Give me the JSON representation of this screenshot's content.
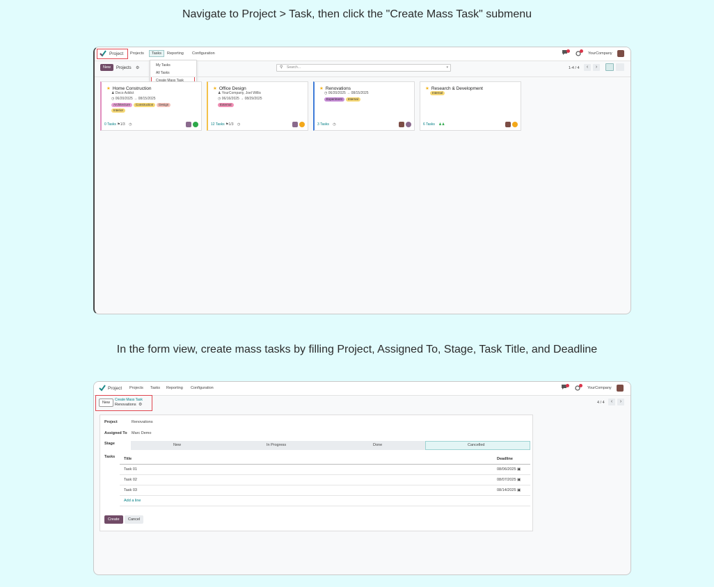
{
  "step1": {
    "caption": "Navigate to Project > Task, then click the \"Create Mass Task\" submenu",
    "nav": {
      "app": "Project",
      "menu": [
        "Projects",
        "Tasks",
        "Reporting",
        "Configuration"
      ],
      "company": "YourCompany"
    },
    "toolbar": {
      "new_label": "New",
      "breadcrumb": "Projects",
      "search_placeholder": "Search...",
      "pager": "1-4 / 4"
    },
    "dropdown": [
      "My Tasks",
      "All Tasks",
      "Create Mass Task"
    ],
    "cards": [
      {
        "title": "Home Construction",
        "person": "Deco Addict",
        "dates": "06/20/2025 → 08/15/2025",
        "tags": [
          "Architecture",
          "Construction",
          "Design",
          "Interior"
        ],
        "tasks": "0 Tasks",
        "milestone": "1/3"
      },
      {
        "title": "Office Design",
        "person": "YourCompany, Joel Willis",
        "dates": "06/16/2025 → 08/29/2025",
        "tags": [
          "External"
        ],
        "tasks": "12 Tasks",
        "milestone": "1/3"
      },
      {
        "title": "Renovations",
        "person": "",
        "dates": "06/20/2025 → 08/15/2025",
        "tags": [
          "Experiment",
          "Internal"
        ],
        "tasks": "3 Tasks",
        "milestone": ""
      },
      {
        "title": "Research & Development",
        "person": "",
        "dates": "",
        "tags": [
          "Internal"
        ],
        "tasks": "6 Tasks",
        "milestone": ""
      }
    ],
    "colors": {
      "accent": "#714b67",
      "teal": "#017e84",
      "highlight": "#e0454e"
    }
  },
  "step2": {
    "caption": "In the form view, create mass tasks by filling Project, Assigned To, Stage, Task Title, and Deadline",
    "nav": {
      "app": "Project",
      "menu": [
        "Projects",
        "Tasks",
        "Reporting",
        "Configuration"
      ],
      "company": "YourCompany"
    },
    "toolbar": {
      "new_label": "New",
      "breadcrumb_top": "Create Mass Task",
      "breadcrumb_bottom": "Renovations",
      "pager": "4 / 4"
    },
    "form": {
      "project_label": "Project",
      "project_value": "Renovations",
      "assigned_label": "Assigned To",
      "assigned_value": "Marc Demo",
      "stage_label": "Stage",
      "stages": [
        "New",
        "In Progress",
        "Done",
        "Cancelled"
      ],
      "tasks_label": "Tasks",
      "col_title": "Title",
      "col_deadline": "Deadline",
      "rows": [
        {
          "title": "Task 01",
          "deadline": "08/06/2025"
        },
        {
          "title": "Task 02",
          "deadline": "08/07/2025"
        },
        {
          "title": "Task 03",
          "deadline": "08/14/2025"
        }
      ],
      "add_line": "Add a line",
      "create_label": "Create",
      "cancel_label": "Cancel"
    }
  }
}
